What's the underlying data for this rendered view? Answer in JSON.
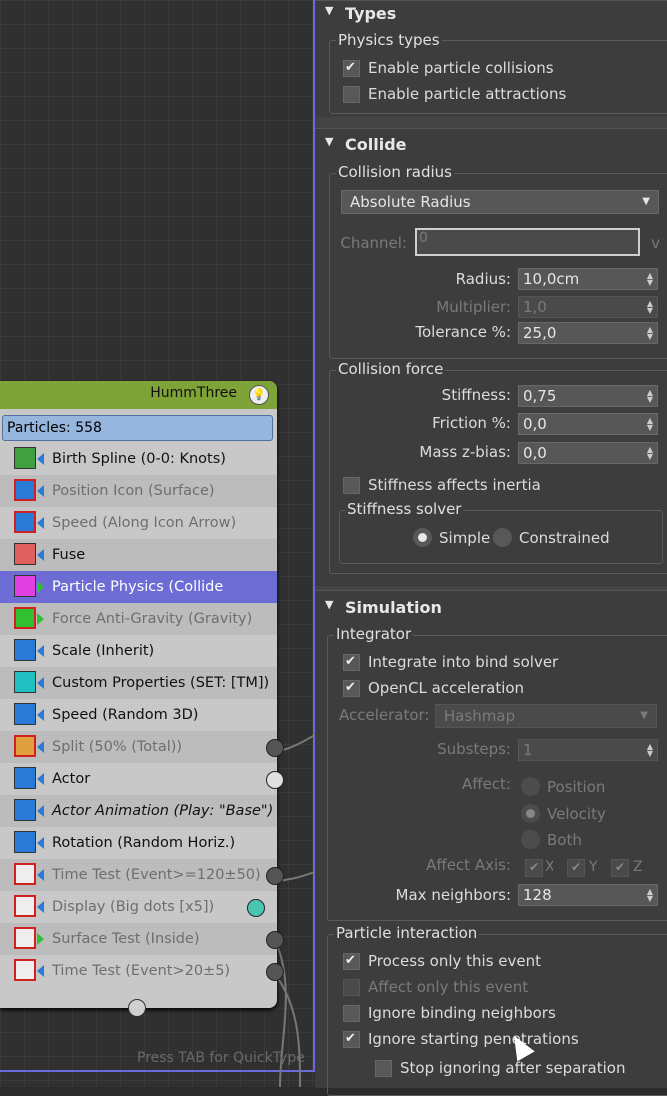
{
  "flow": {
    "quicktype_hint": "Press TAB for QuickType",
    "node": {
      "title": "HummThree",
      "particles": "Particles: 558",
      "operators": [
        {
          "label": "Birth Spline (0-0: Knots)",
          "state": "normal",
          "icon": "spline-icon",
          "icon_color": "#40a040"
        },
        {
          "label": "Position Icon (Surface)",
          "state": "disabled",
          "icon": "position-icon",
          "icon_color": "#2a7ad8"
        },
        {
          "label": "Speed (Along Icon Arrow)",
          "state": "disabled",
          "icon": "speed-icon",
          "icon_color": "#2a7ad8"
        },
        {
          "label": "Fuse",
          "state": "normal",
          "icon": "fuse-icon",
          "icon_color": "#e06060"
        },
        {
          "label": "Particle Physics (Collide [Integ…",
          "state": "selected",
          "icon": "physics-icon",
          "icon_color": "#e040e0"
        },
        {
          "label": "Force Anti-Gravity (Gravity)",
          "state": "disabled",
          "icon": "force-icon",
          "icon_color": "#30c030"
        },
        {
          "label": "Scale (Inherit)",
          "state": "normal",
          "icon": "scale-icon",
          "icon_color": "#2a7ad8"
        },
        {
          "label": "Custom Properties (SET: [TM])",
          "state": "normal",
          "icon": "custom-properties-icon",
          "icon_color": "#20c0c0"
        },
        {
          "label": "Speed (Random 3D)",
          "state": "normal",
          "icon": "speed-icon",
          "icon_color": "#2a7ad8"
        },
        {
          "label": "Split (50% (Total))",
          "state": "disabled",
          "icon": "split-icon",
          "icon_color": "#e0a040"
        },
        {
          "label": "Actor",
          "state": "normal",
          "icon": "actor-icon",
          "icon_color": "#2a7ad8"
        },
        {
          "label": "Actor Animation (Play: \"Base\")",
          "state": "italic",
          "icon": "actor-animation-icon",
          "icon_color": "#2a7ad8"
        },
        {
          "label": "Rotation (Random Horiz.)",
          "state": "normal",
          "icon": "rotation-icon",
          "icon_color": "#2a7ad8"
        },
        {
          "label": "Time Test (Event>=120±50)",
          "state": "disabled",
          "icon": "time-test-icon",
          "icon_color": "#eeeeee"
        },
        {
          "label": "Display (Big dots [x5])",
          "state": "disabled",
          "icon": "display-icon",
          "icon_color": "#eeeeee"
        },
        {
          "label": "Surface Test (Inside)",
          "state": "disabled",
          "icon": "surface-test-icon",
          "icon_color": "#eeeeee"
        },
        {
          "label": "Time Test (Event>20±5)",
          "state": "disabled",
          "icon": "time-test-icon",
          "icon_color": "#eeeeee"
        }
      ]
    }
  },
  "panel": {
    "types": {
      "title": "Types",
      "group": "Physics types",
      "enable_collisions": "Enable particle collisions",
      "enable_attractions": "Enable particle attractions"
    },
    "collide": {
      "title": "Collide",
      "group": "Collision radius",
      "radius_mode": "Absolute Radius",
      "channel_label": "Channel:",
      "channel_value": "0",
      "channel_suffix": "v",
      "radius_label": "Radius:",
      "radius_value": "10,0cm",
      "multiplier_label": "Multiplier:",
      "multiplier_value": "1,0",
      "tolerance_label": "Tolerance %:",
      "tolerance_value": "25,0",
      "force_group": "Collision force",
      "stiffness_label": "Stiffness:",
      "stiffness_value": "0,75",
      "friction_label": "Friction %:",
      "friction_value": "0,0",
      "mass_label": "Mass z-bias:",
      "mass_value": "0,0",
      "stiffness_inertia": "Stiffness affects inertia",
      "solver_group": "Stiffness solver",
      "solver_simple": "Simple",
      "solver_constrained": "Constrained"
    },
    "simulation": {
      "title": "Simulation",
      "integrator_group": "Integrator",
      "integrate_bind": "Integrate into bind solver",
      "opencl": "OpenCL acceleration",
      "accelerator_label": "Accelerator:",
      "accelerator_value": "Hashmap",
      "substeps_label": "Substeps:",
      "substeps_value": "1",
      "affect_label": "Affect:",
      "affect_position": "Position",
      "affect_velocity": "Velocity",
      "affect_both": "Both",
      "affect_axis_label": "Affect Axis:",
      "axis_x": "X",
      "axis_y": "Y",
      "axis_z": "Z",
      "max_neighbors_label": "Max neighbors:",
      "max_neighbors_value": "128",
      "interaction_group": "Particle interaction",
      "process_only": "Process only this event",
      "affect_only": "Affect only this event",
      "ignore_binding": "Ignore binding neighbors",
      "ignore_starting": "Ignore starting penetrations",
      "stop_ignoring": "Stop ignoring after separation"
    }
  }
}
